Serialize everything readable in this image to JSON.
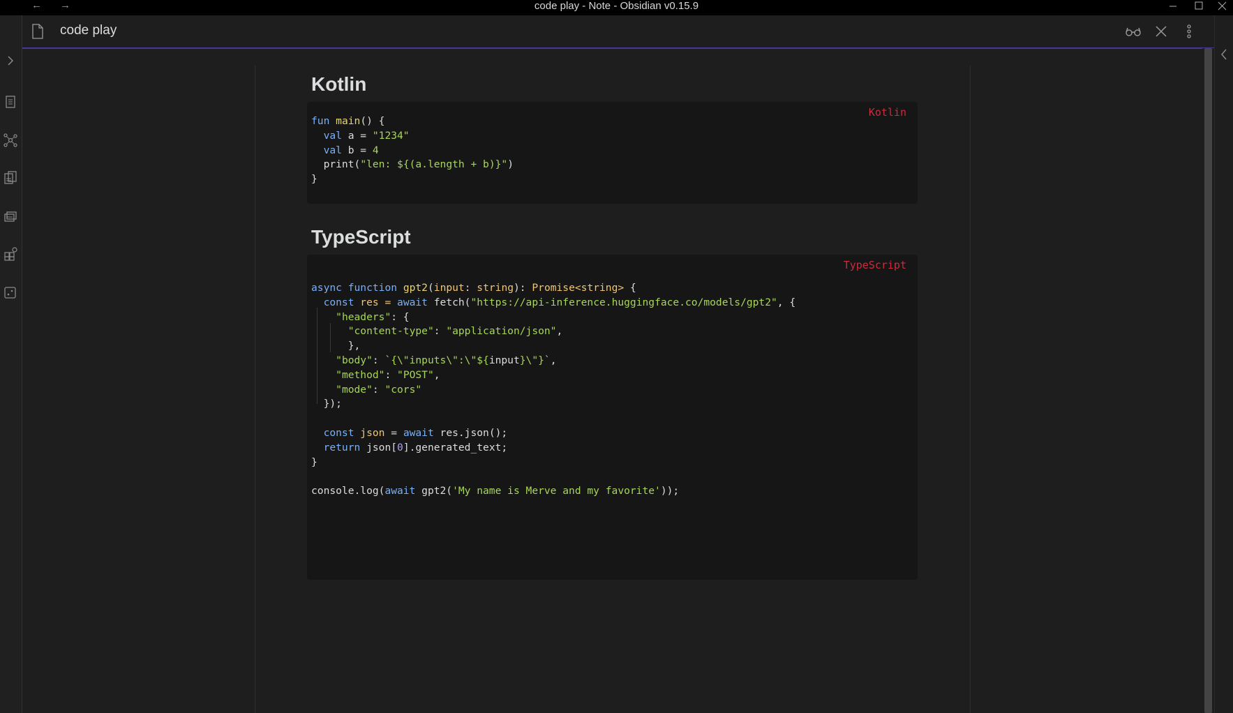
{
  "window": {
    "title": "code play - Note - Obsidian v0.15.9",
    "back_glyph": "←",
    "forward_glyph": "→"
  },
  "ribbon": {
    "icons": [
      "expand-sidebar-icon",
      "open-quick-switcher-icon",
      "graph-view-icon",
      "templates-icon",
      "slides-icon",
      "plugins-icon",
      "random-note-icon"
    ]
  },
  "view": {
    "title": "code play",
    "actions": [
      "reading-view-icon",
      "close-icon",
      "more-options-icon"
    ]
  },
  "colors": {
    "accent": "#483699",
    "language_label": "#d02a3c",
    "keyword": "#7ab0f8",
    "string": "#a8d65a",
    "function": "#e8d474"
  },
  "sections": [
    {
      "heading": "Kotlin",
      "language": "Kotlin"
    },
    {
      "heading": "TypeScript",
      "language": "TypeScript"
    }
  ],
  "kotlin_code": {
    "l1_kw": "fun",
    "l1_fn": "main",
    "l1_rest": "() {",
    "l2_kw": "val",
    "l2_mid": " a = ",
    "l2_str": "\"1234\"",
    "l3_kw": "val",
    "l3_mid": " b = ",
    "l3_num": "4",
    "l4_fn": "print",
    "l4_open": "(",
    "l4_str1": "\"len: ${(a.length + b)}\"",
    "l4_close": ")",
    "l5": "}"
  },
  "ts_code": {
    "l1_kw1": "async",
    "l1_kw2": "function",
    "l1_fn": "gpt2",
    "l1_a": "(",
    "l1_p": "input",
    "l1_b": ": ",
    "l1_t1": "string",
    "l1_c": "): ",
    "l1_t2": "Promise<string>",
    "l1_d": " {",
    "l2_kw1": "const",
    "l2_v": " res = ",
    "l2_kw2": "await",
    "l2_fn": " fetch(",
    "l2_str": "\"https://api-inference.huggingface.co/models/gpt2\"",
    "l2_end": ", {",
    "l3_str": "\"headers\"",
    "l3_end": ": {",
    "l4_str1": "\"content-type\"",
    "l4_mid": ": ",
    "l4_str2": "\"application/json\"",
    "l4_end": ",",
    "l5": "},",
    "l6_str1": "\"body\"",
    "l6_mid": ": ",
    "l6_str2": "`{\\\"inputs\\\":\\\"${",
    "l6_var": "input",
    "l6_str3": "}\\\"}`",
    "l6_end": ",",
    "l7_str1": "\"method\"",
    "l7_mid": ": ",
    "l7_str2": "\"POST\"",
    "l7_end": ",",
    "l8_str1": "\"mode\"",
    "l8_mid": ": ",
    "l8_str2": "\"cors\"",
    "l9": "});",
    "l11_kw1": "const",
    "l11_var": " json",
    "l11_eq": " = ",
    "l11_kw2": "await",
    "l11_rest": " res.json();",
    "l12_kw": "return",
    "l12_a": " json[",
    "l12_num": "0",
    "l12_b": "].generated_text;",
    "l13": "}",
    "l15_a": "console.log(",
    "l15_kw": "await",
    "l15_b": " gpt2(",
    "l15_str": "'My name is Merve and my favorite'",
    "l15_c": "));"
  }
}
